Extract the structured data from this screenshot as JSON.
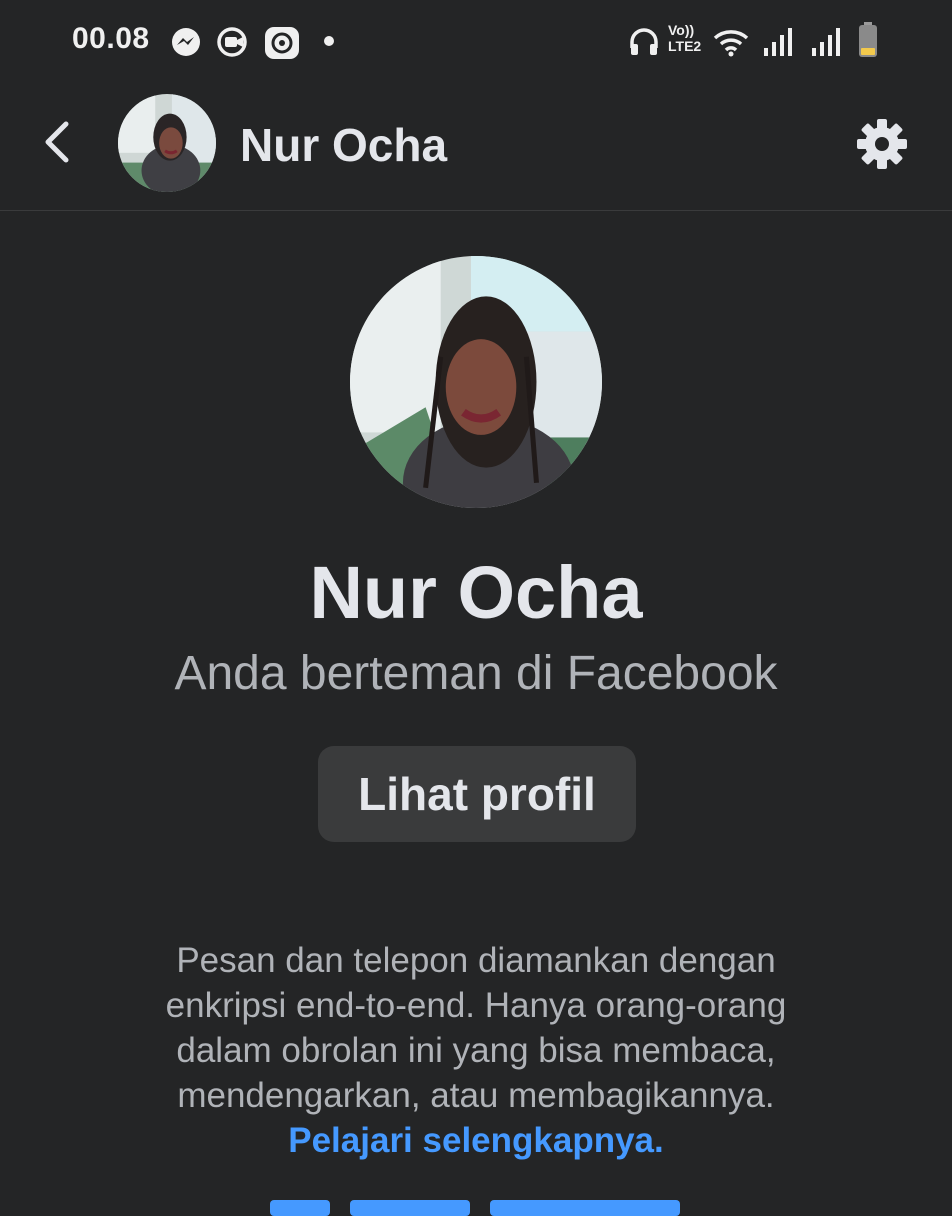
{
  "status_bar": {
    "time": "00.08",
    "network_label": "Vo)) LTE2",
    "icons": [
      "messenger-icon",
      "screen-record-icon",
      "settings-app-icon",
      "dot-icon",
      "headphones-icon",
      "volte-icon",
      "wifi-icon",
      "signal-icon",
      "signal-icon",
      "battery-icon"
    ]
  },
  "header": {
    "name": "Nur Ocha"
  },
  "profile": {
    "name": "Nur Ocha",
    "friend_note": "Anda berteman di Facebook",
    "view_profile_label": "Lihat profil"
  },
  "encryption": {
    "text": "Pesan dan telepon diamankan dengan enkripsi end-to-end. Hanya orang-orang dalam obrolan ini yang bisa membaca, mendengarkan, atau membagikannya.",
    "learn_more": "Pelajari selengkapnya."
  },
  "colors": {
    "background": "#242526",
    "button_bg": "#3a3b3c",
    "link": "#4599ff",
    "battery_level": "#f2c94c"
  }
}
